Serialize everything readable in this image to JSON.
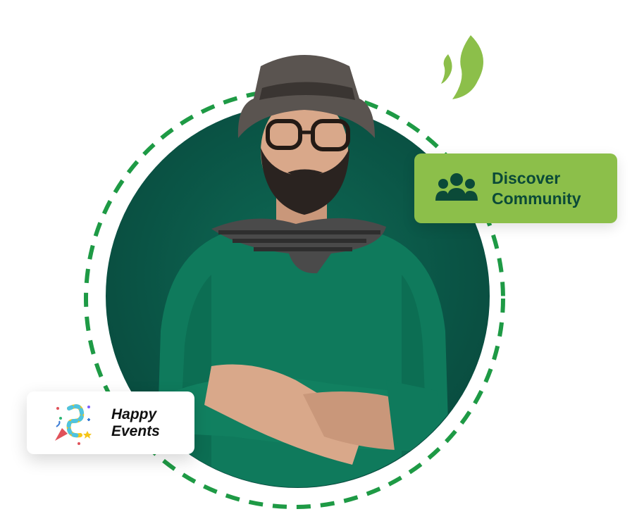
{
  "badges": {
    "community": {
      "line1": "Discover",
      "line2": "Community",
      "icon": "community-group-icon"
    },
    "events": {
      "line1": "Happy",
      "line2": "Events",
      "icon": "party-popper-icon"
    }
  },
  "colors": {
    "brand_green": "#8cbf4a",
    "dark_green": "#0b4a38",
    "ring_green": "#1e9a45",
    "circle_bg": "#0a5445"
  }
}
